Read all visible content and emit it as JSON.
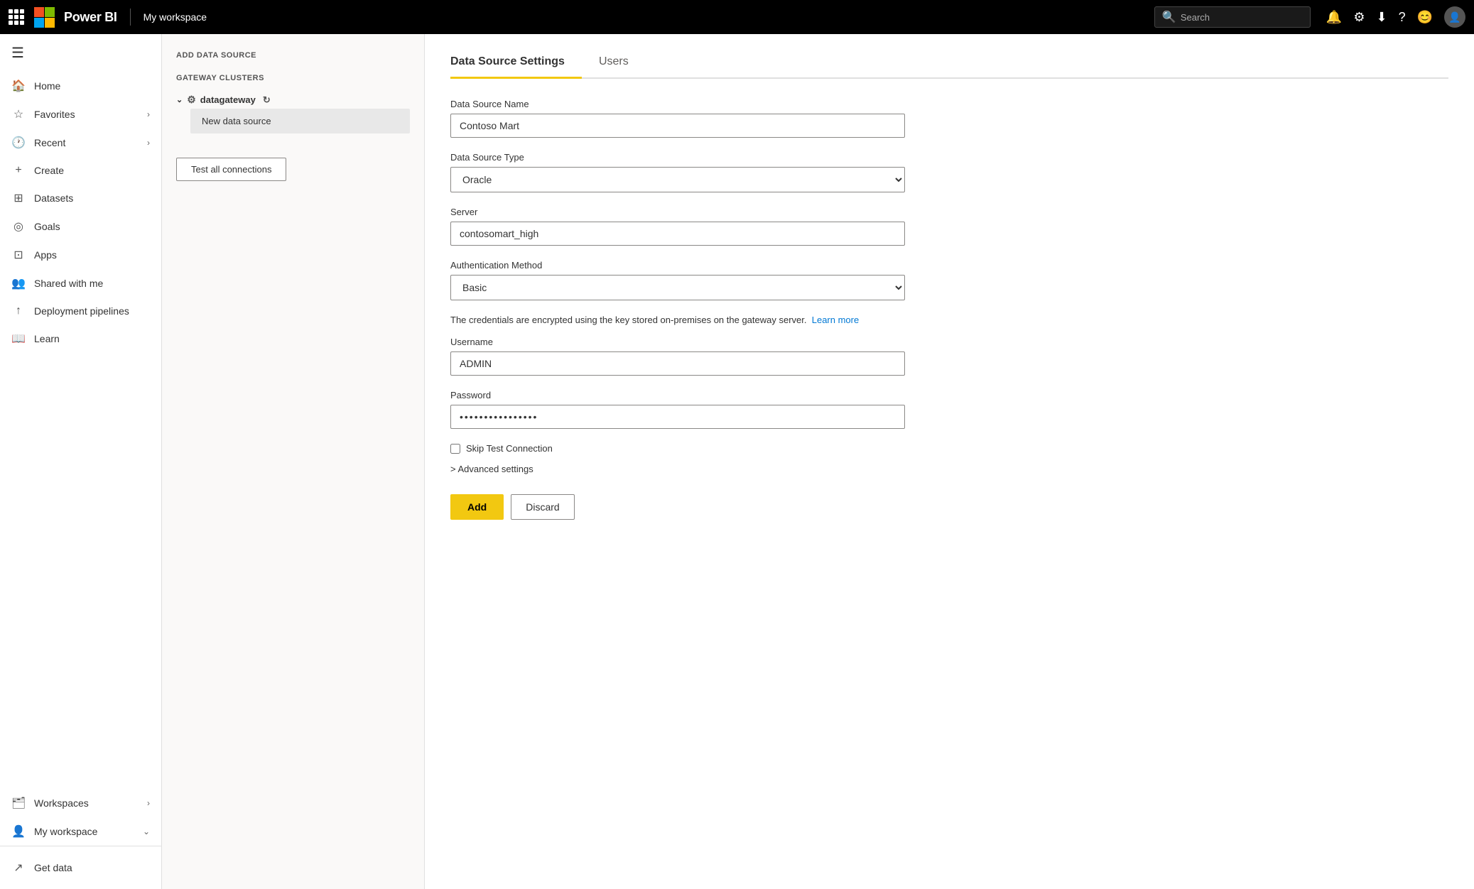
{
  "topnav": {
    "brand": "Power BI",
    "workspace": "My workspace",
    "search_placeholder": "Search",
    "search_value": ""
  },
  "sidebar": {
    "toggle_icon": "☰",
    "items": [
      {
        "id": "home",
        "label": "Home",
        "icon": "🏠"
      },
      {
        "id": "favorites",
        "label": "Favorites",
        "icon": "☆",
        "has_chevron": true
      },
      {
        "id": "recent",
        "label": "Recent",
        "icon": "🕐",
        "has_chevron": true
      },
      {
        "id": "create",
        "label": "Create",
        "icon": "+"
      },
      {
        "id": "datasets",
        "label": "Datasets",
        "icon": "⊞"
      },
      {
        "id": "goals",
        "label": "Goals",
        "icon": "🎯"
      },
      {
        "id": "apps",
        "label": "Apps",
        "icon": "⊡"
      },
      {
        "id": "shared",
        "label": "Shared with me",
        "icon": "👤"
      },
      {
        "id": "deployment",
        "label": "Deployment pipelines",
        "icon": "🚀"
      },
      {
        "id": "learn",
        "label": "Learn",
        "icon": "📖"
      },
      {
        "id": "workspaces",
        "label": "Workspaces",
        "icon": "🗂",
        "has_chevron": true
      },
      {
        "id": "myworkspace",
        "label": "My workspace",
        "icon": "👤",
        "has_chevron_down": true
      }
    ],
    "get_data": "Get data",
    "get_data_icon": "↗"
  },
  "left_panel": {
    "section_label": "ADD DATA SOURCE",
    "gateway_section_label": "GATEWAY CLUSTERS",
    "gateway_name": "datagateway",
    "datasource_item": "New data source",
    "test_button": "Test all connections"
  },
  "right_panel": {
    "tabs": [
      {
        "id": "settings",
        "label": "Data Source Settings",
        "active": true
      },
      {
        "id": "users",
        "label": "Users",
        "active": false
      }
    ],
    "form": {
      "datasource_name_label": "Data Source Name",
      "datasource_name_value": "Contoso Mart",
      "datasource_type_label": "Data Source Type",
      "datasource_type_value": "Oracle",
      "server_label": "Server",
      "server_value": "contosomart_high",
      "auth_method_label": "Authentication Method",
      "auth_method_value": "Basic",
      "credentials_note": "The credentials are encrypted using the key stored on-premises on the gateway server.",
      "learn_more_link": "Learn more",
      "username_label": "Username",
      "username_value": "ADMIN",
      "password_label": "Password",
      "password_value": "••••••••••••••••",
      "skip_test_label": "Skip Test Connection",
      "advanced_settings_label": "> Advanced settings",
      "add_button": "Add",
      "discard_button": "Discard"
    }
  }
}
